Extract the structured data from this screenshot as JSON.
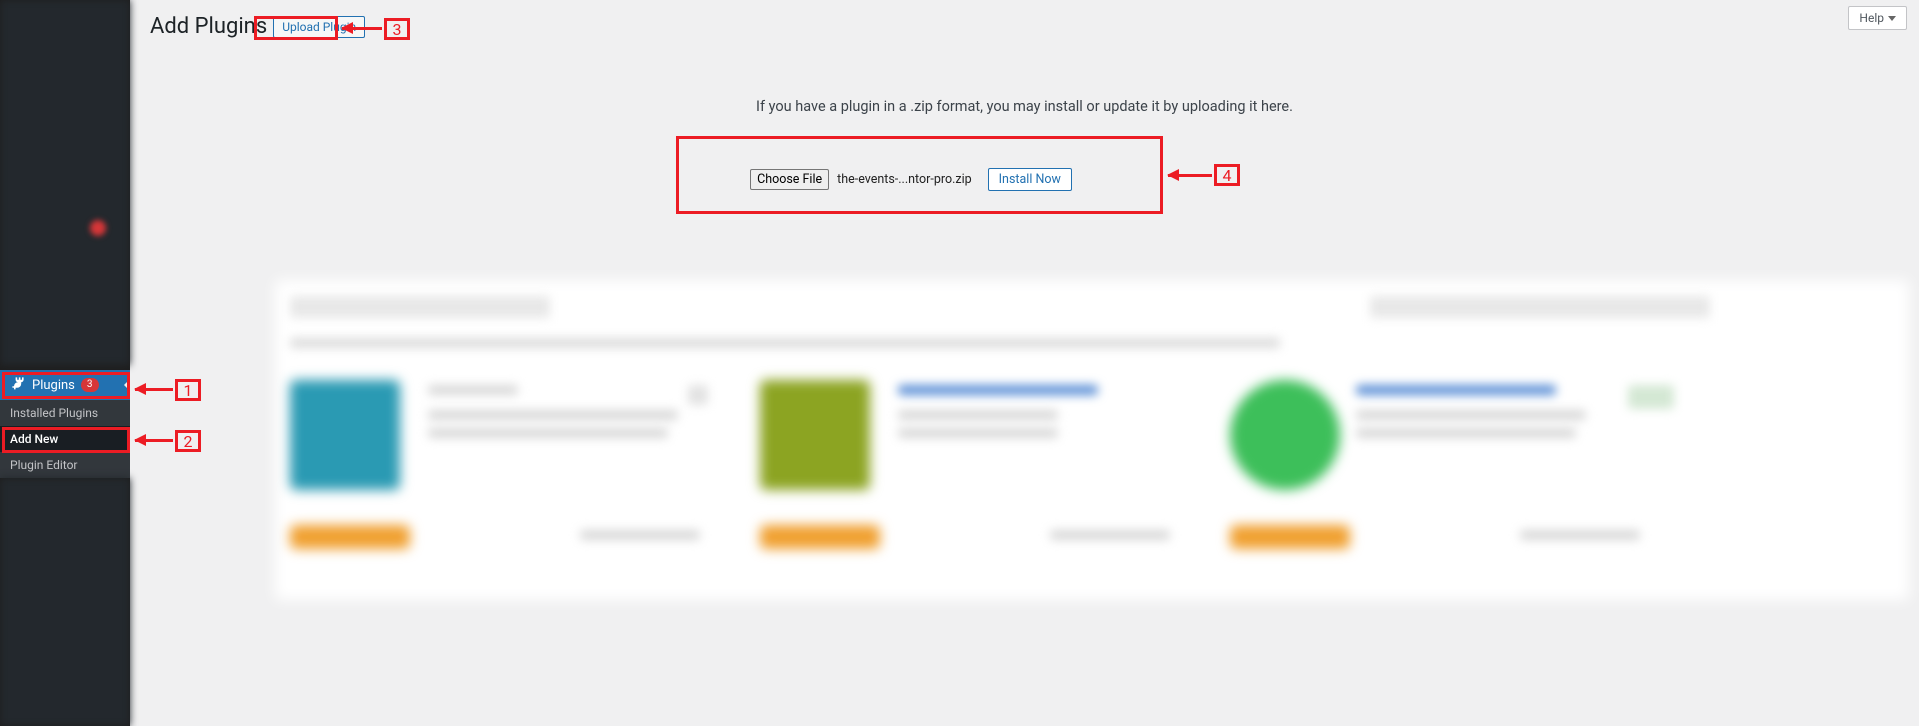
{
  "sidebar": {
    "plugins": {
      "label": "Plugins",
      "badge": "3"
    },
    "sub": {
      "installed": "Installed Plugins",
      "addnew": "Add New",
      "editor": "Plugin Editor"
    }
  },
  "header": {
    "title": "Add Plugins",
    "upload_button": "Upload Plugin",
    "help": "Help"
  },
  "upload": {
    "instruction": "If you have a plugin in a .zip format, you may install or update it by uploading it here.",
    "choose_file": "Choose File",
    "file_name": "the-events-...ntor-pro.zip",
    "install_now": "Install Now"
  },
  "annotations": {
    "n1": "1",
    "n2": "2",
    "n3": "3",
    "n4": "4"
  }
}
